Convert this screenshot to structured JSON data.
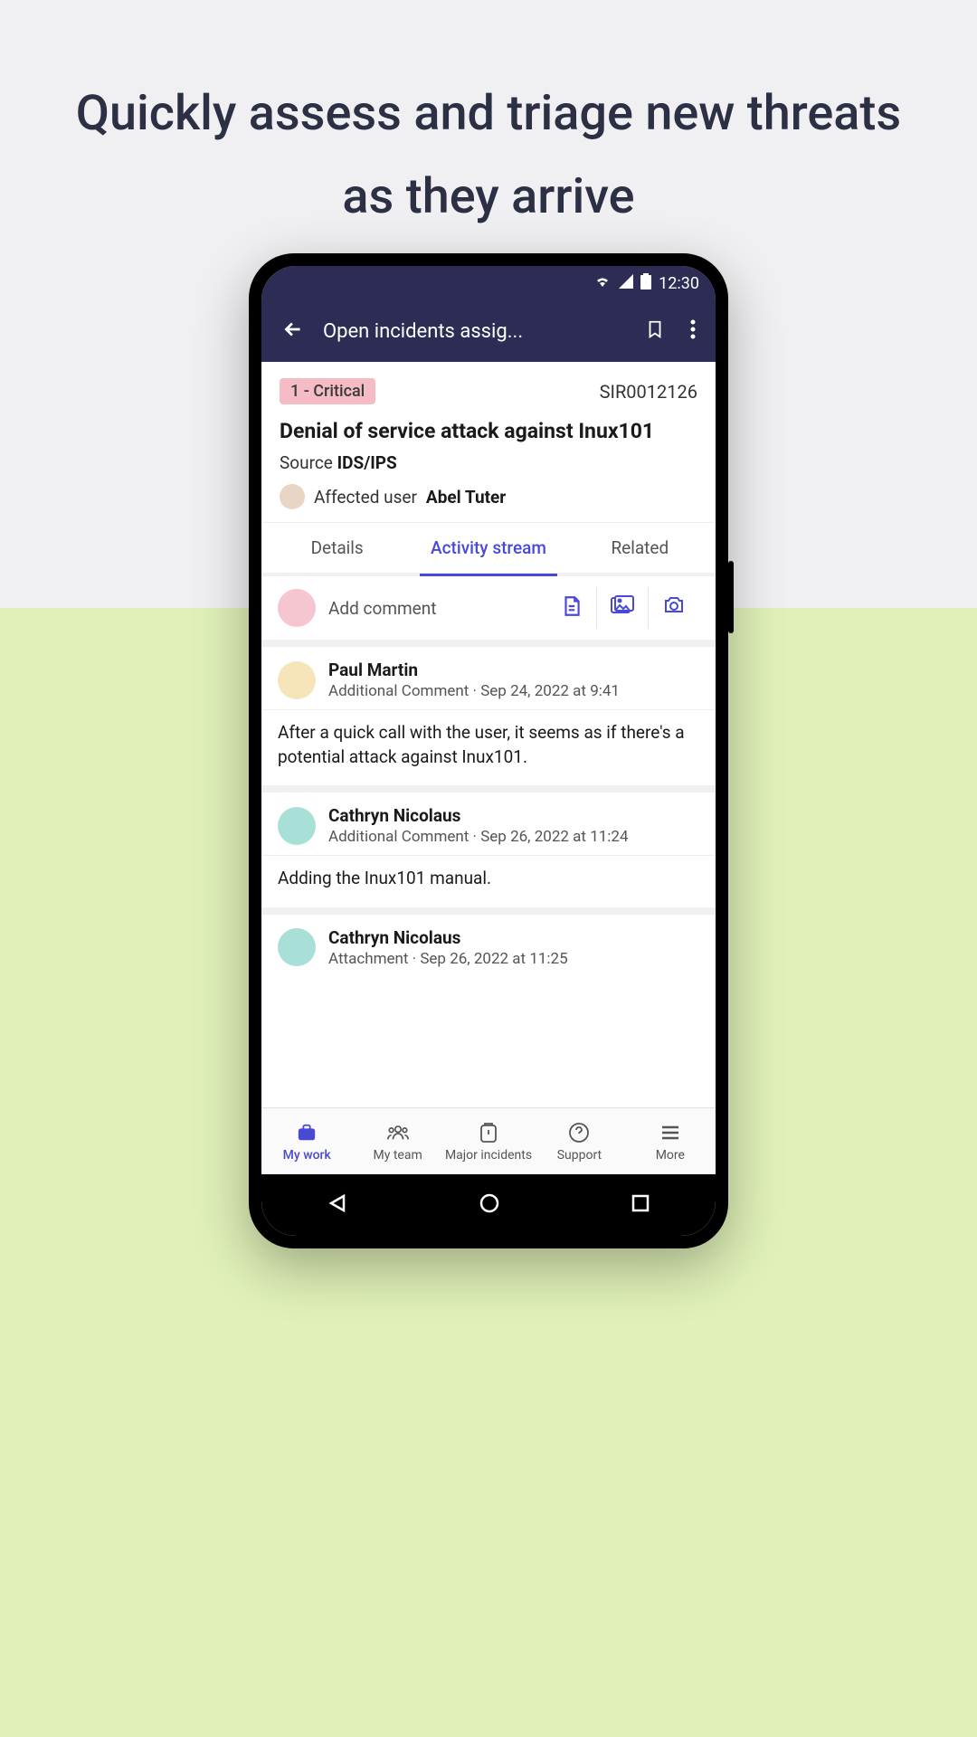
{
  "headline": "Quickly assess and triage new threats as they arrive",
  "status_bar": {
    "time": "12:30"
  },
  "app_bar": {
    "title": "Open incidents assig..."
  },
  "incident": {
    "priority": "1 - Critical",
    "ticket_id": "SIR0012126",
    "title": "Denial of service attack against Inux101",
    "source_label": "Source",
    "source_value": "IDS/IPS",
    "affected_label": "Affected user",
    "affected_user": "Abel Tuter"
  },
  "tabs": {
    "details": "Details",
    "activity": "Activity stream",
    "related": "Related"
  },
  "comment_input": {
    "placeholder": "Add comment"
  },
  "stream": [
    {
      "author": "Paul Martin",
      "type": "Additional Comment",
      "time": "Sep 24, 2022 at 9:41",
      "body": "After a quick call with the user, it seems as if there's a potential attack against Inux101."
    },
    {
      "author": "Cathryn Nicolaus",
      "type": "Additional Comment",
      "time": "Sep 26, 2022 at 11:24",
      "body": "Adding the Inux101 manual."
    },
    {
      "author": "Cathryn Nicolaus",
      "type": "Attachment",
      "time": "Sep 26, 2022 at 11:25",
      "body": ""
    }
  ],
  "bottom_nav": {
    "my_work": "My work",
    "my_team": "My team",
    "major": "Major incidents",
    "support": "Support",
    "more": "More"
  }
}
